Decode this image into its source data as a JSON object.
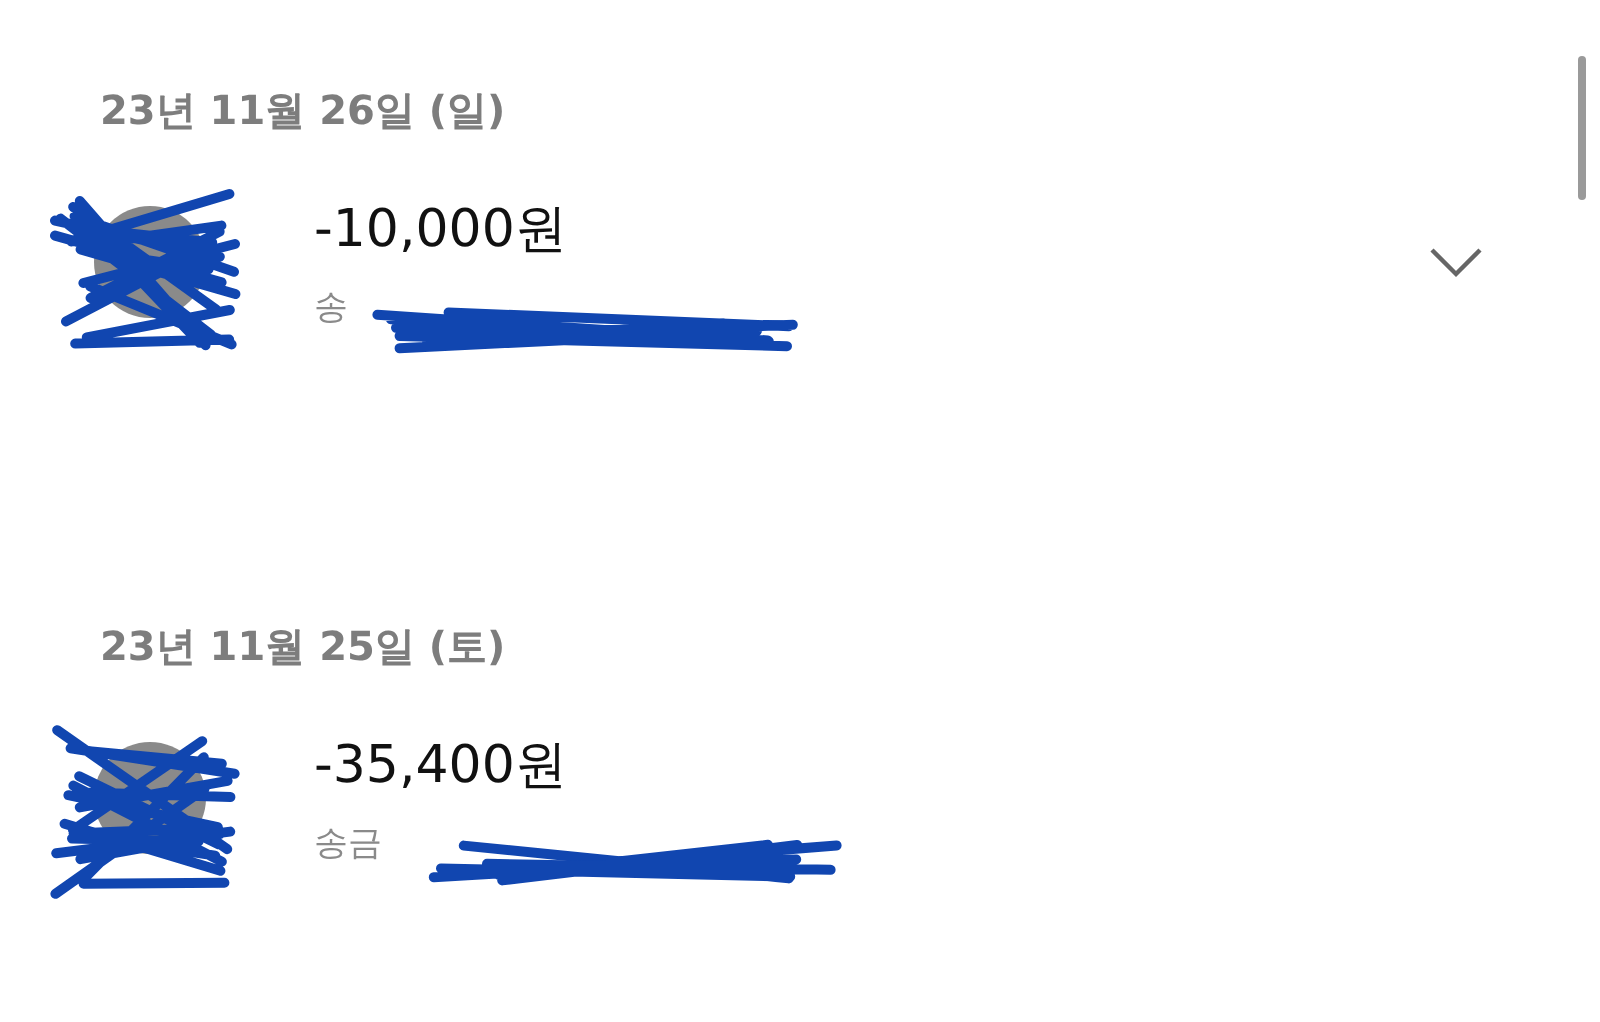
{
  "sections": [
    {
      "date": "23년 11월 26일 (일)",
      "transaction": {
        "amount": "-10,000원",
        "type": "송",
        "expandable": true
      }
    },
    {
      "date": "23년 11월 25일 (토)",
      "transaction": {
        "amount": "-35,400원",
        "type": "송금",
        "expandable": false
      }
    }
  ]
}
